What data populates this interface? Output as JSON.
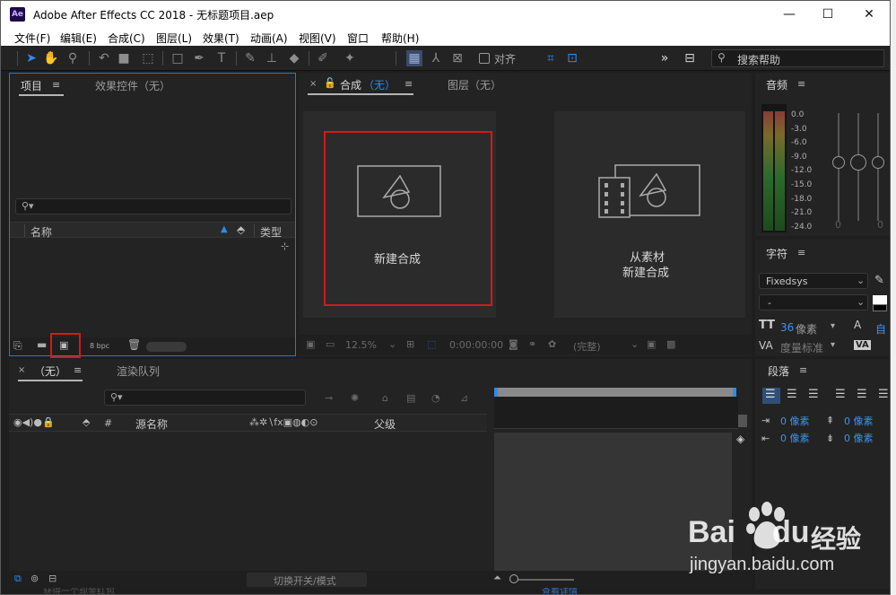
{
  "window": {
    "app_icon": "Ae",
    "title": "Adobe After Effects CC 2018 - 无标题项目.aep",
    "minimize": "—",
    "maximize": "☐",
    "close": "✕"
  },
  "menu": [
    "文件(F)",
    "编辑(E)",
    "合成(C)",
    "图层(L)",
    "效果(T)",
    "动画(A)",
    "视图(V)",
    "窗口",
    "帮助(H)"
  ],
  "toolbar": {
    "snap_label": "对齐",
    "search_placeholder": "搜索帮助",
    "more": "»"
  },
  "project_panel": {
    "tab_project": "项目",
    "tab_effects": "效果控件（无）",
    "col_name": "名称",
    "col_type": "类型",
    "bpc": "8 bpc"
  },
  "comp_panel": {
    "tab_comp": "合成",
    "tab_comp_state": "（无）",
    "tab_layer": "图层（无）",
    "new_comp_label": "新建合成",
    "from_footage_line1": "从素材",
    "from_footage_line2": "新建合成",
    "zoom": "12.5%",
    "timecode": "0:00:00:00",
    "quality": "(完整)"
  },
  "audio_panel": {
    "title": "音频",
    "levels": [
      "0.0",
      "-3.0",
      "-6.0",
      "-9.0",
      "-12.0",
      "-15.0",
      "-18.0",
      "-21.0",
      "-24.0"
    ],
    "slider_left": "0",
    "slider_right": "0"
  },
  "character_panel": {
    "title": "字符",
    "font_family": "Fixedsys",
    "font_style": "-",
    "font_size_value": "36",
    "font_size_unit": "像素",
    "leading_label": "自",
    "kerning_label": "度量标准",
    "tracking_label": "VA"
  },
  "timeline_panel": {
    "tab_comp": "（无）",
    "tab_render": "渲染队列",
    "col_source": "源名称",
    "col_parent": "父级",
    "col_hash": "#",
    "toggle_label": "切换开关/模式"
  },
  "paragraph_panel": {
    "title": "段落",
    "indent_left": "0 像素",
    "indent_right": "0 像素",
    "space_before": "0 像素",
    "space_after": "0 像素"
  },
  "watermark": {
    "brand_text": "Bai",
    "brand_text2": "du",
    "brand_cn": "经验",
    "url": "jingyan.baidu.com"
  },
  "behind_window": {
    "left_text": "获得一个现金红包",
    "right_text": "查看详情"
  },
  "colors": {
    "accent_blue": "#2d8ceb",
    "highlight_red": "#d21a1a",
    "panel_bg": "#232323",
    "app_bg": "#1e1e1e"
  }
}
